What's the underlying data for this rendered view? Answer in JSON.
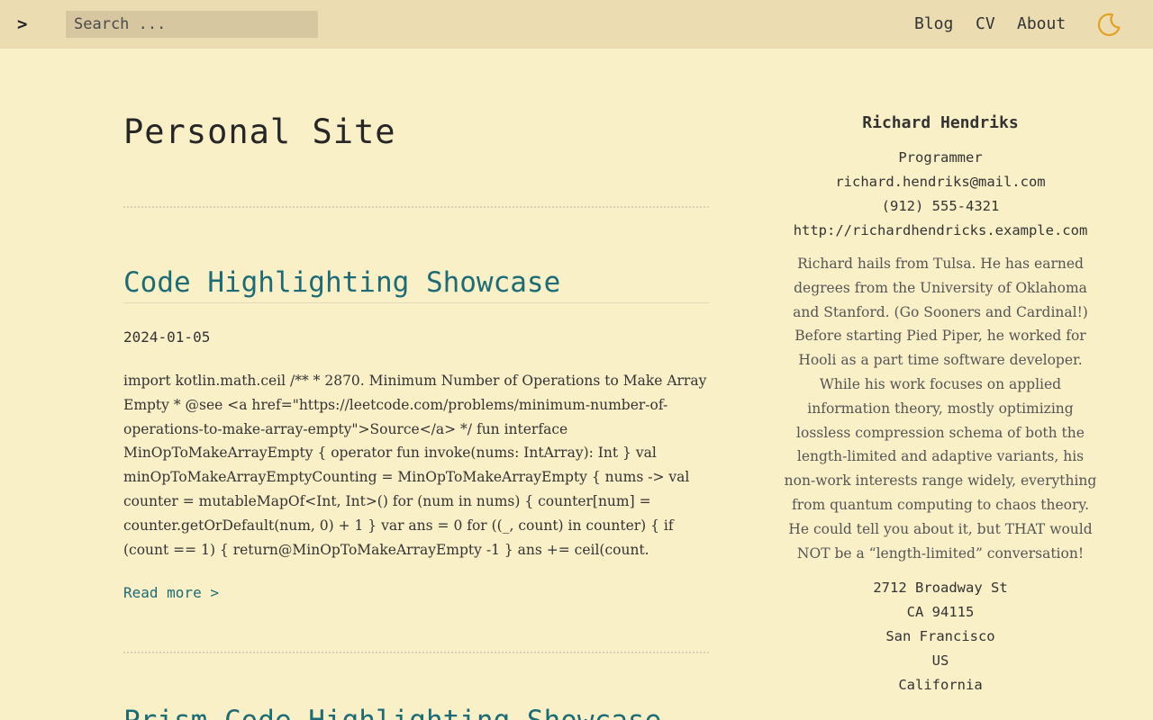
{
  "header": {
    "prompt": ">",
    "search_placeholder": "Search ...",
    "nav": [
      "Blog",
      "CV",
      "About"
    ],
    "theme_icon": "moon-icon",
    "accent_color": "#e2a122"
  },
  "main": {
    "page_title": "Personal Site",
    "posts": [
      {
        "title": "Code Highlighting Showcase",
        "date": "2024-01-05",
        "excerpt": "import kotlin.math.ceil /** * 2870. Minimum Number of Operations to Make Array Empty * @see <a href=\"https://leetcode.com/problems/minimum-number-of-operations-to-make-array-empty\">Source</a> */ fun interface MinOpToMakeArrayEmpty { operator fun invoke(nums: IntArray): Int } val minOpToMakeArrayEmptyCounting = MinOpToMakeArrayEmpty { nums -> val counter = mutableMapOf<Int, Int>() for (num in nums) { counter[num] = counter.getOrDefault(num, 0) + 1 } var ans = 0 for ((_, count) in counter) { if (count == 1) { return@MinOpToMakeArrayEmpty -1 } ans += ceil(count.",
        "read_more": "Read more >"
      },
      {
        "title": "Prism Code Highlighting Showcase"
      }
    ],
    "link_color": "#1d6b74"
  },
  "sidebar": {
    "name": "Richard Hendriks",
    "role": "Programmer",
    "email": "richard.hendriks@mail.com",
    "phone": "(912) 555-4321",
    "website": "http://richardhendricks.example.com",
    "bio": "Richard hails from Tulsa. He has earned degrees from the University of Oklahoma and Stanford. (Go Sooners and Cardinal!) Before starting Pied Piper, he worked for Hooli as a part time software developer. While his work focuses on applied information theory, mostly optimizing lossless compression schema of both the length-limited and adaptive variants, his non-work interests range widely, everything from quantum computing to chaos theory. He could tell you about it, but THAT would NOT be a “length-limited” conversation!",
    "address": [
      "2712 Broadway St",
      "CA 94115",
      "San Francisco",
      "US",
      "California"
    ]
  }
}
